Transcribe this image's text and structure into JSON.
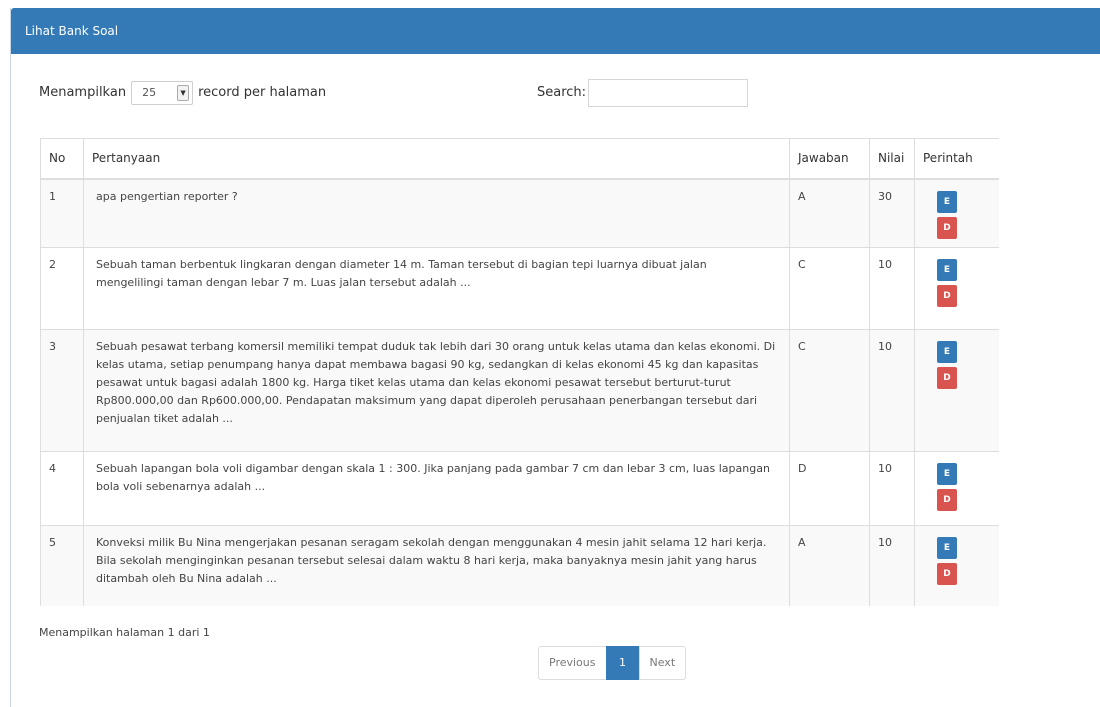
{
  "panel": {
    "title": "Lihat Bank Soal"
  },
  "length": {
    "label_before": "Menampilkan",
    "value": "25",
    "label_after": "record per halaman"
  },
  "search": {
    "label": "Search:",
    "value": "",
    "placeholder": ""
  },
  "table": {
    "headers": [
      "No",
      "Pertanyaan",
      "Jawaban",
      "Nilai",
      "Perintah"
    ],
    "rows": [
      {
        "no": "1",
        "question": "apa pengertian reporter ?",
        "answer": "A",
        "value": "30",
        "edit": "E",
        "delete": "D"
      },
      {
        "no": "2",
        "question": "Sebuah taman berbentuk lingkaran dengan diameter 14 m. Taman tersebut di bagian tepi luarnya dibuat jalan mengelilingi taman dengan lebar 7 m. Luas jalan tersebut adalah ...",
        "answer": "C",
        "value": "10",
        "edit": "E",
        "delete": "D"
      },
      {
        "no": "3",
        "question": "Sebuah pesawat terbang komersil memiliki tempat duduk tak lebih dari 30 orang untuk kelas utama dan kelas ekonomi. Di kelas utama, setiap penumpang hanya dapat membawa bagasi 90 kg, sedangkan di kelas ekonomi 45 kg dan kapasitas pesawat untuk bagasi adalah 1800 kg. Harga tiket kelas utama dan kelas ekonomi pesawat tersebut berturut-turut Rp800.000,00 dan Rp600.000,00. Pendapatan maksimum yang dapat diperoleh perusahaan penerbangan tersebut dari penjualan tiket adalah ...",
        "answer": "C",
        "value": "10",
        "edit": "E",
        "delete": "D"
      },
      {
        "no": "4",
        "question": "Sebuah lapangan bola voli digambar dengan skala 1 : 300. Jika panjang pada gambar 7 cm dan lebar 3 cm, luas lapangan bola voli sebenarnya adalah ...",
        "answer": "D",
        "value": "10",
        "edit": "E",
        "delete": "D"
      },
      {
        "no": "5",
        "question": "Konveksi milik Bu Nina mengerjakan pesanan seragam sekolah dengan menggunakan 4 mesin jahit selama 12 hari kerja. Bila sekolah menginginkan pesanan tersebut selesai dalam waktu 8 hari kerja, maka banyaknya mesin jahit yang harus ditambah oleh Bu Nina adalah ...",
        "answer": "A",
        "value": "10",
        "edit": "E",
        "delete": "D"
      }
    ]
  },
  "footer": {
    "info": "Menampilkan halaman 1 dari 1",
    "prev": "Previous",
    "page": "1",
    "next": "Next"
  }
}
